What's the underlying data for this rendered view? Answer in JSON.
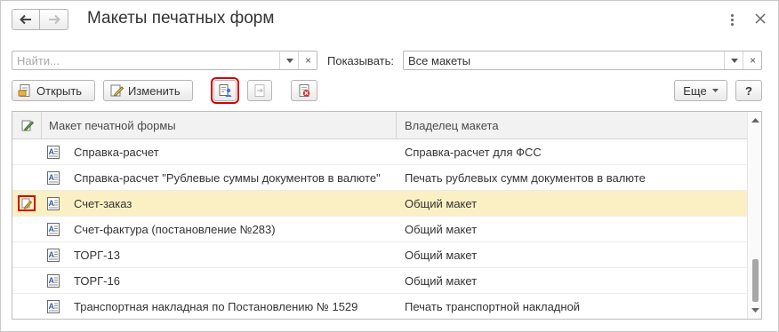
{
  "window": {
    "title": "Макеты печатных форм"
  },
  "search": {
    "placeholder": "Найти...",
    "value": "",
    "clear_glyph": "×"
  },
  "filter": {
    "label": "Показывать:",
    "value": "Все макеты",
    "clear_glyph": "×"
  },
  "toolbar": {
    "open_label": "Открыть",
    "edit_label": "Изменить",
    "more_label": "Еще",
    "help_label": "?"
  },
  "table": {
    "columns": [
      "Макет печатной формы",
      "Владелец макета"
    ],
    "rows": [
      {
        "name": "Справка-расчет",
        "owner": "Справка-расчет для ФСС",
        "modified": false,
        "selected": false
      },
      {
        "name": "Справка-расчет \"Рублевые суммы документов в валюте\"",
        "owner": "Печать рублевых сумм документов в валюте",
        "modified": false,
        "selected": false
      },
      {
        "name": "Счет-заказ",
        "owner": "Общий макет",
        "modified": true,
        "selected": true
      },
      {
        "name": "Счет-фактура (постановление №283)",
        "owner": "Общий макет",
        "modified": false,
        "selected": false
      },
      {
        "name": "ТОРГ-13",
        "owner": "Общий макет",
        "modified": false,
        "selected": false
      },
      {
        "name": "ТОРГ-16",
        "owner": "Общий макет",
        "modified": false,
        "selected": false
      },
      {
        "name": "Транспортная накладная по Постановлению № 1529",
        "owner": "Печать транспортной накладной",
        "modified": false,
        "selected": false
      }
    ]
  },
  "icons": {
    "back": "arrow-left-icon",
    "forward": "arrow-right-icon",
    "menu": "more-vertical-icon",
    "close": "close-icon",
    "open": "open-document-icon",
    "edit": "edit-pencil-icon",
    "use_modified": "use-modified-template-icon",
    "use_standard": "use-standard-template-icon",
    "delete": "delete-template-icon",
    "template": "spreadsheet-template-icon",
    "modified_marker": "modified-pencil-icon"
  },
  "colors": {
    "selected_row": "#fbf0c4",
    "highlight_frame": "#d40000",
    "header_bg": "#f2f2f2"
  }
}
